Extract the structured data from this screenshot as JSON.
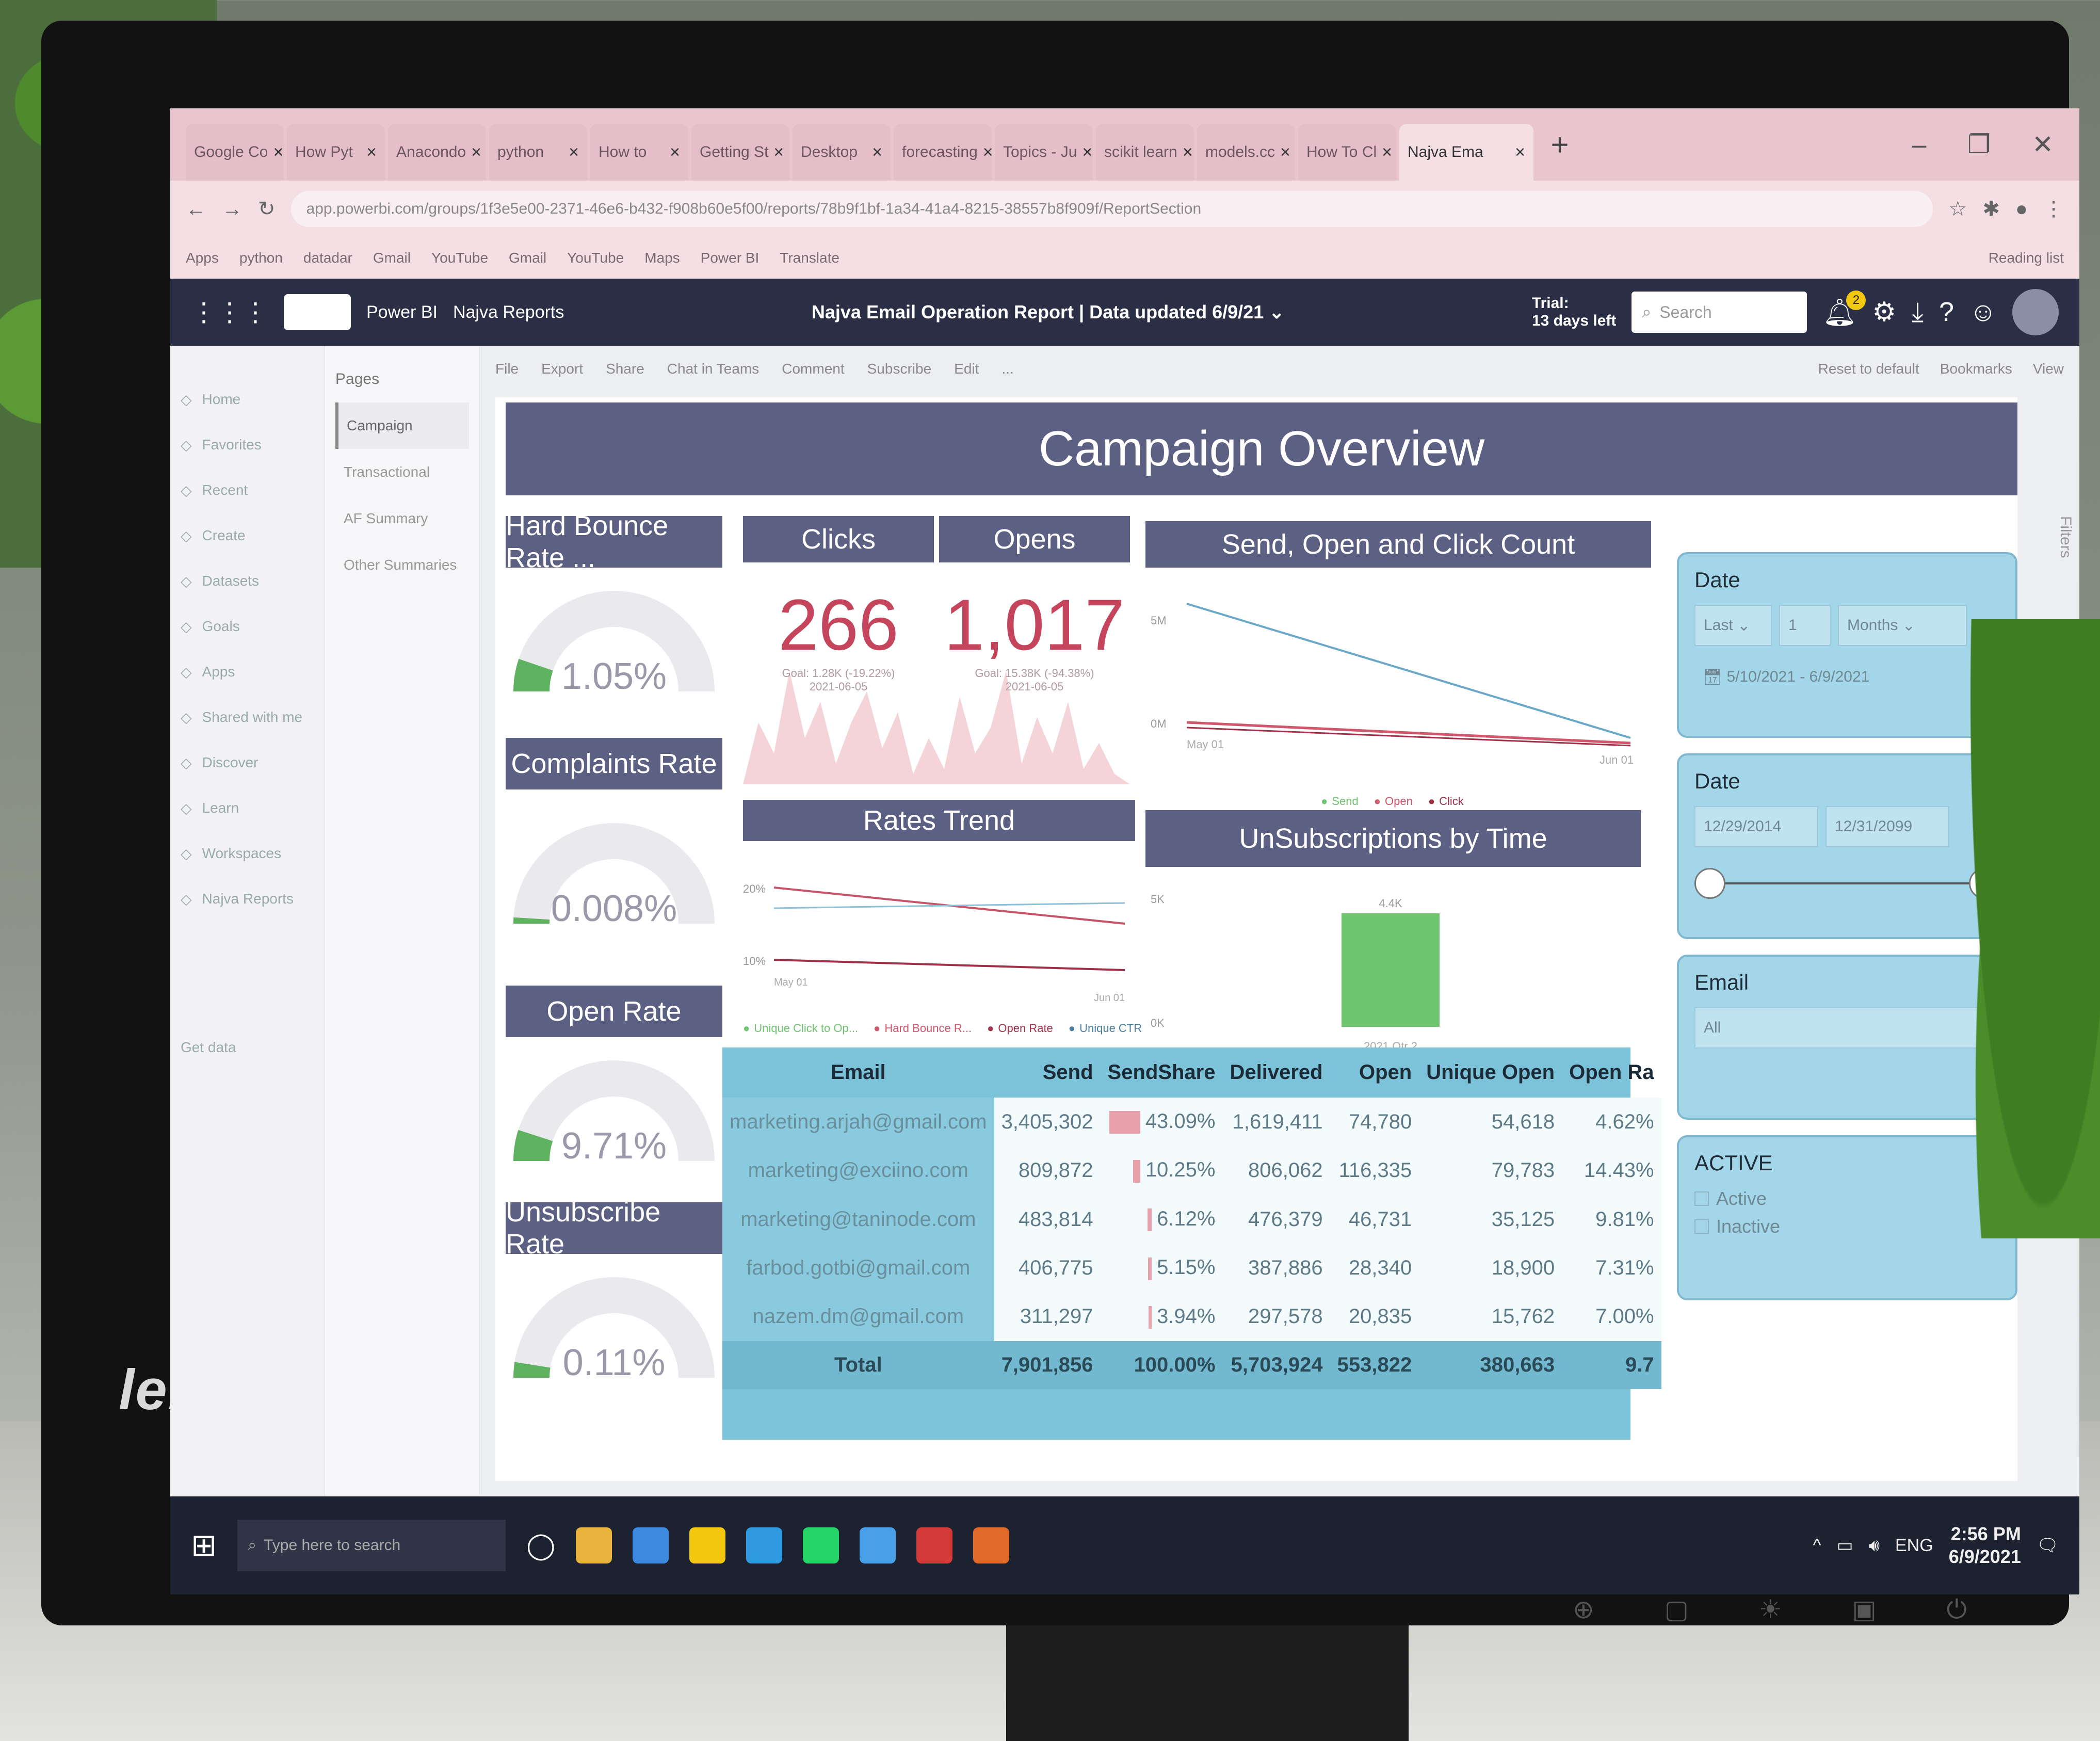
{
  "brand": "lenovo",
  "browser": {
    "tabs": [
      "Google Co",
      "How Pyt",
      "Anacondo",
      "python",
      "How to",
      "Getting St",
      "Desktop",
      "forecasting",
      "Topics - Ju",
      "scikit learn",
      "models.cc",
      "How To Cl",
      "Najva Ema"
    ],
    "url": "app.powerbi.com/groups/1f3e5e00-2371-46e6-b432-f908b60e5f00/reports/78b9f1bf-1a34-41a4-8215-38557b8f909f/ReportSection",
    "bookmarks": [
      "Apps",
      "python",
      "datadar",
      "Gmail",
      "YouTube",
      "Gmail",
      "YouTube",
      "Maps",
      "Power BI",
      "Translate"
    ],
    "reading_list": "Reading list"
  },
  "header": {
    "app": "Power BI",
    "workspace": "Najva Reports",
    "report_title": "Najva Email Operation Report | Data updated 6/9/21",
    "trial_line1": "Trial:",
    "trial_line2": "13 days left",
    "search_placeholder": "Search",
    "notif_count": "2"
  },
  "nav": [
    "Home",
    "Favorites",
    "Recent",
    "Create",
    "Datasets",
    "Goals",
    "Apps",
    "Shared with me",
    "Discover",
    "Learn",
    "Workspaces",
    "Najva Reports"
  ],
  "nav_footer": "Get data",
  "pages": {
    "header": "Pages",
    "items": [
      "Campaign",
      "Transactional",
      "AF Summary",
      "Other Summaries"
    ]
  },
  "toolbar": {
    "left": [
      "File",
      "Export",
      "Share",
      "Chat in Teams",
      "Comment",
      "Subscribe",
      "Edit",
      "..."
    ],
    "right": [
      "Reset to default",
      "Bookmarks",
      "View"
    ]
  },
  "report": {
    "title": "Campaign Overview",
    "gauges": [
      {
        "title": "Hard Bounce Rate ...",
        "value": "1.05%",
        "fill": 0.105,
        "max": "10.0%"
      },
      {
        "title": "Complaints Rate",
        "value": "0.008%",
        "fill": 0.02,
        "max": "0.20%"
      },
      {
        "title": "Open Rate",
        "value": "9.71%",
        "fill": 0.1,
        "max": "100%"
      },
      {
        "title": "Unsubscribe Rate",
        "value": "0.11%",
        "fill": 0.05,
        "max": "2.0%"
      }
    ],
    "clicks": {
      "title": "Clicks",
      "value": "266",
      "goal": "Goal: 1.28K (-19.22%)",
      "date": "2021-06-05"
    },
    "opens": {
      "title": "Opens",
      "value": "1,017",
      "goal": "Goal: 15.38K (-94.38%)",
      "date": "2021-06-05"
    },
    "send_chart": {
      "title": "Send, Open and Click Count",
      "legend": [
        "Send",
        "Open",
        "Click"
      ],
      "x_start": "May 01",
      "x_end": "Jun 01",
      "y_top": "5M",
      "y_bottom": "0M"
    },
    "rates_trend": {
      "title": "Rates Trend",
      "legend": [
        "Unique Click to Op...",
        "Hard Bounce R...",
        "Open Rate",
        "Unique CTR"
      ],
      "x_start": "May 01",
      "x_end": "Jun 01",
      "y_top": "20%",
      "y_bottom": "10%"
    },
    "unsub": {
      "title": "UnSubscriptions by Time",
      "bar_label": "4.4K",
      "bar_value": 4.4,
      "x_label": "2021 Qtr 2",
      "y_top": "5K",
      "y_bottom": "0K"
    }
  },
  "table": {
    "columns": [
      "Email",
      "Send",
      "SendShare",
      "Delivered",
      "Open",
      "Unique Open",
      "Open Ra"
    ],
    "rows": [
      [
        "marketing.arjah@gmail.com",
        "3,405,302",
        "43.09%",
        "1,619,411",
        "74,780",
        "54,618",
        "4.62%"
      ],
      [
        "marketing@exciino.com",
        "809,872",
        "10.25%",
        "806,062",
        "116,335",
        "79,783",
        "14.43%"
      ],
      [
        "marketing@taninode.com",
        "483,814",
        "6.12%",
        "476,379",
        "46,731",
        "35,125",
        "9.81%"
      ],
      [
        "farbod.gotbi@gmail.com",
        "406,775",
        "5.15%",
        "387,886",
        "28,340",
        "18,900",
        "7.31%"
      ],
      [
        "nazem.dm@gmail.com",
        "311,297",
        "3.94%",
        "297,578",
        "20,835",
        "15,762",
        "7.00%"
      ]
    ],
    "share_fill": [
      0.43,
      0.1,
      0.06,
      0.05,
      0.04
    ],
    "total": [
      "Total",
      "7,901,856",
      "100.00%",
      "5,703,924",
      "553,822",
      "380,663",
      "9.7"
    ]
  },
  "slicers": {
    "date1": {
      "label": "Date",
      "mode": "Last",
      "count": "1",
      "unit": "Months",
      "range": "5/10/2021 - 6/9/2021"
    },
    "date2": {
      "label": "Date",
      "from": "12/29/2014",
      "to": "12/31/2099"
    },
    "email": {
      "label": "Email",
      "value": "All"
    },
    "active": {
      "label": "ACTIVE",
      "options": [
        "Active",
        "Inactive"
      ]
    }
  },
  "filters_label": "Filters",
  "taskbar": {
    "search_placeholder": "Type here to search",
    "lang": "ENG",
    "time": "2:56 PM",
    "date": "6/9/2021"
  },
  "colors": {
    "accent": "#5c6083",
    "kpi": "#c5465c",
    "slicer": "#a3d6e8",
    "pbi_header": "#2a2f45",
    "tab_bar": "#e9c6cf"
  }
}
